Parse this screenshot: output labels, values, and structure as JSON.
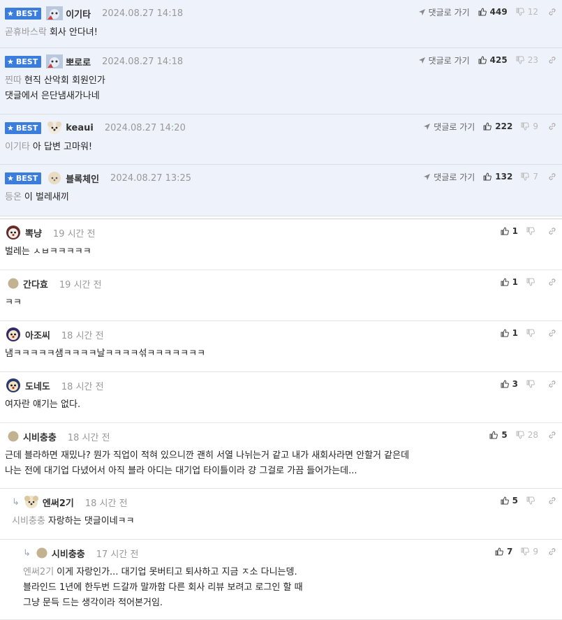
{
  "best_label": "BEST",
  "goto_label": "댓글로 가기",
  "best_comments": [
    {
      "nick": "이기타",
      "time": "2024.08.27 14:18",
      "likes": "449",
      "dislikes": "12",
      "mention": "곧휴바스락",
      "text": "회사 안다녀!"
    },
    {
      "nick": "뽀로로",
      "time": "2024.08.27 14:18",
      "likes": "425",
      "dislikes": "23",
      "mention": "찐따",
      "text": "현직 산악회 회원인가\n댓글에서 은단냄새가나네"
    },
    {
      "nick": "keaui",
      "time": "2024.08.27 14:20",
      "likes": "222",
      "dislikes": "9",
      "mention": "이기타",
      "text": "아 답변 고마워!"
    },
    {
      "nick": "블록체인",
      "time": "2024.08.27 13:25",
      "likes": "132",
      "dislikes": "7",
      "mention": "등온",
      "text": "이 벌레새끼"
    }
  ],
  "comments": [
    {
      "nick": "뽁냥",
      "time": "19 시간 전",
      "likes": "1",
      "dislikes": "",
      "mention": "",
      "text": "벌레는 ㅅㅂㅋㅋㅋㅋㅋ"
    },
    {
      "nick": "간다효",
      "time": "19 시간 전",
      "likes": "1",
      "dislikes": "",
      "mention": "",
      "text": "ㅋㅋ"
    },
    {
      "nick": "아조씨",
      "time": "18 시간 전",
      "likes": "1",
      "dislikes": "",
      "mention": "",
      "text": "냄ㅋㅋㅋㅋㅋ샘ㅋㅋㅋㅋ날ㅋㅋㅋㅋ섞ㅋㅋㅋㅋㅋㅋㅋ"
    },
    {
      "nick": "도네도",
      "time": "18 시간 전",
      "likes": "3",
      "dislikes": "",
      "mention": "",
      "text": "여자란 얘기는 없다."
    },
    {
      "nick": "시비충충",
      "time": "18 시간 전",
      "likes": "5",
      "dislikes": "28",
      "mention": "",
      "text": "근데 블라하면 재밌나? 뭔가 직업이 적혀 있으니깐 괜히 서열 나뉘는거 같고 내가 새회사라면 안할거 같은데\n나는 전에 대기업 다녔어서 아직 블라 아디는 대기업 타이틀이라 걍 그걸로 가끔 들어가는데..."
    },
    {
      "nick": "엔써2기",
      "time": "18 시간 전",
      "likes": "5",
      "dislikes": "",
      "mention": "시비충충",
      "text": "자랑하는 댓글이네ㅋㅋ"
    },
    {
      "nick": "시비충충",
      "time": "17 시간 전",
      "likes": "7",
      "dislikes": "9",
      "mention": "엔써2기",
      "text": "이게 자랑인가... 대기업 못버티고 퇴사하고 지금 ㅈ소 다니는뎅.\n블라인드 1년에 한두번 드갈까 말까함 다른 회사 리뷰 보려고 로그인 할 때\n그냥 문득 드는 생각이라 적어본거임."
    }
  ]
}
